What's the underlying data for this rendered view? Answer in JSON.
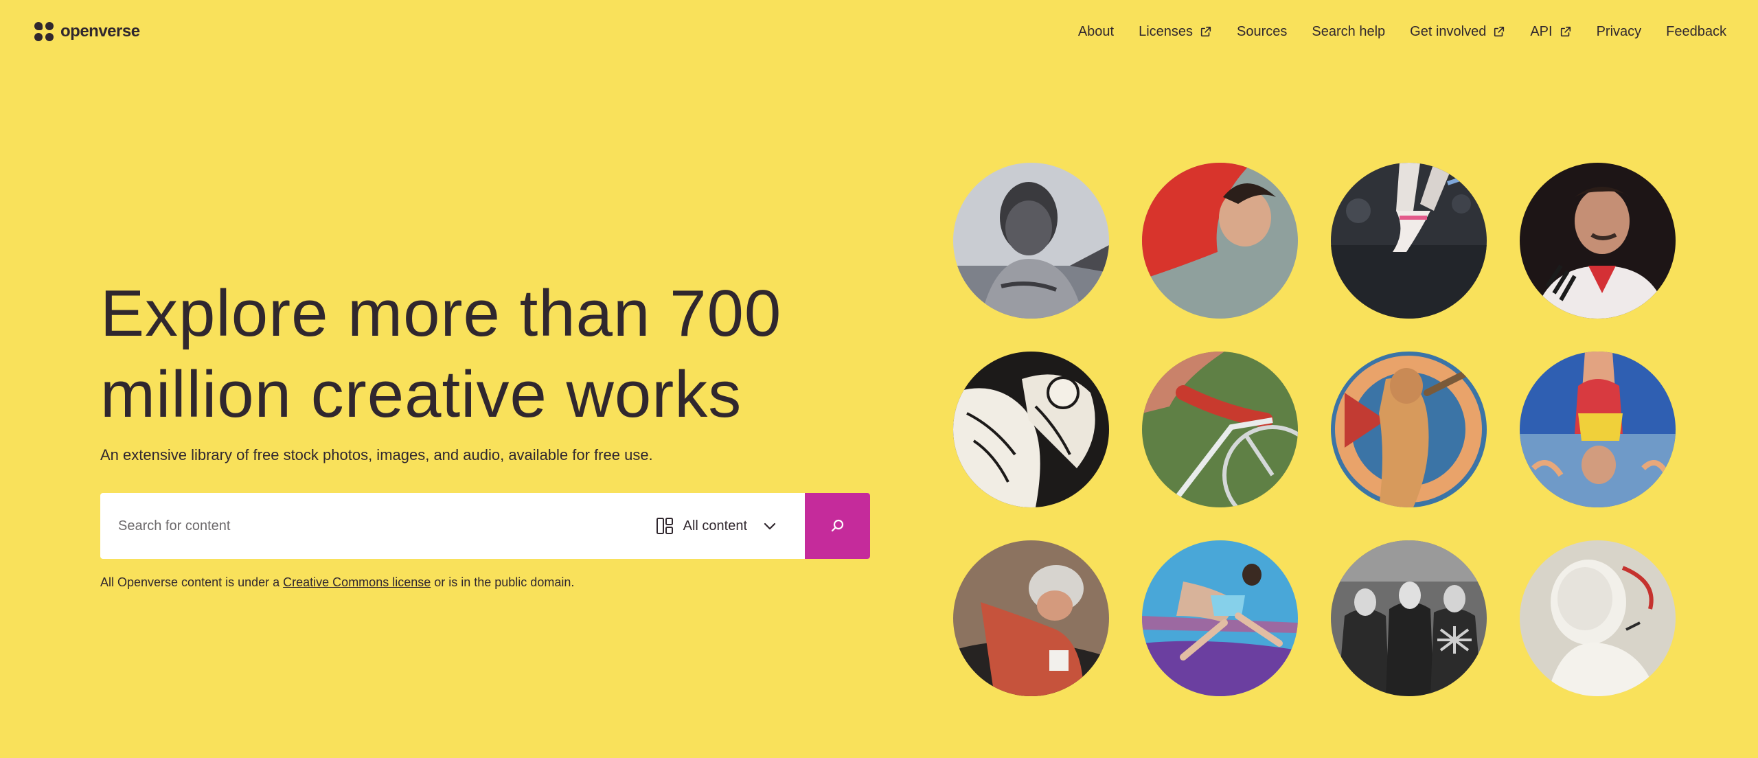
{
  "brand": {
    "name": "openverse"
  },
  "nav": {
    "items": [
      {
        "label": "About",
        "external": false
      },
      {
        "label": "Licenses",
        "external": true
      },
      {
        "label": "Sources",
        "external": false
      },
      {
        "label": "Search help",
        "external": false
      },
      {
        "label": "Get involved",
        "external": true
      },
      {
        "label": "API",
        "external": true
      },
      {
        "label": "Privacy",
        "external": false
      },
      {
        "label": "Feedback",
        "external": false
      }
    ]
  },
  "hero": {
    "title_line1": "Explore more than 700",
    "title_line2": "million creative works",
    "subtitle": "An extensive library of free stock photos, images, and audio, available for free use."
  },
  "search": {
    "placeholder": "Search for content",
    "value": "",
    "content_type": "All content",
    "button_icon": "search-icon"
  },
  "license_note": {
    "before": "All Openverse content is under a ",
    "link": "Creative Commons license",
    "after": " or is in the public domain."
  },
  "colors": {
    "background": "#f9e15b",
    "text": "#30272e",
    "accent": "#c52b9b",
    "input_bg": "#ffffff"
  },
  "gallery": {
    "images": [
      {
        "name": "athlete-bw-portrait"
      },
      {
        "name": "gymnast-red-shirt"
      },
      {
        "name": "gymnast-hands-rings"
      },
      {
        "name": "athlete-red-white-jersey"
      },
      {
        "name": "illustrated-wrestlers"
      },
      {
        "name": "cyclist-track-bike"
      },
      {
        "name": "painted-athlete-poster"
      },
      {
        "name": "gymnast-upside-down"
      },
      {
        "name": "cyclist-helmet-red-jersey"
      },
      {
        "name": "sprinter-motion-blur"
      },
      {
        "name": "women-team-bw"
      },
      {
        "name": "fencer-mask"
      }
    ]
  }
}
